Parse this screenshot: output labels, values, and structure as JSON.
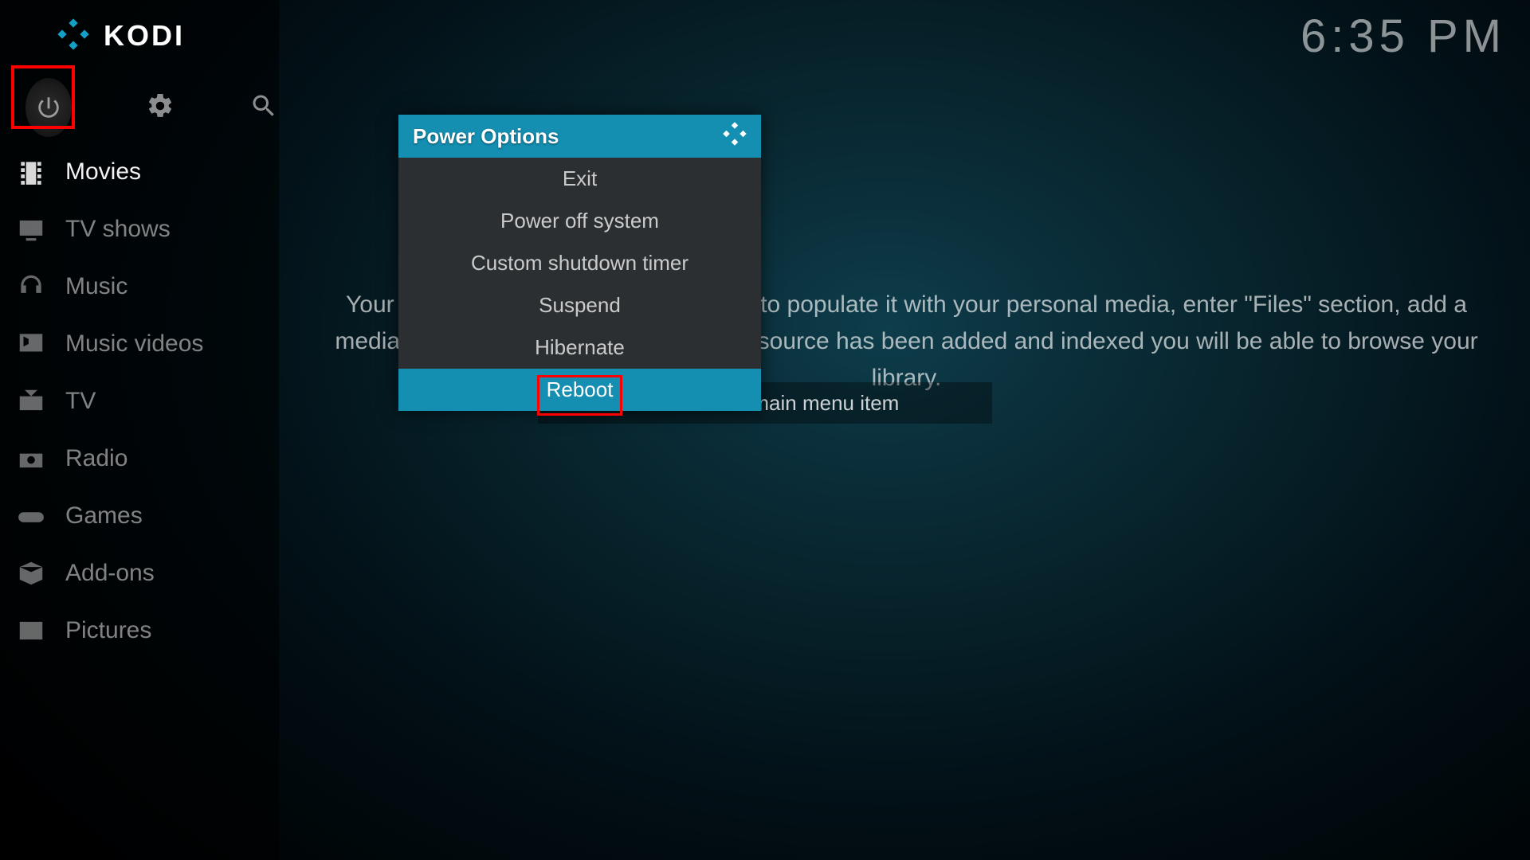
{
  "brand": "KODI",
  "clock": "6:35 PM",
  "sidebar": {
    "items": [
      {
        "icon": "film-icon",
        "label": "Movies",
        "active": true
      },
      {
        "icon": "tv-display-icon",
        "label": "TV shows"
      },
      {
        "icon": "headphones-icon",
        "label": "Music"
      },
      {
        "icon": "music-video-icon",
        "label": "Music videos"
      },
      {
        "icon": "tv-antenna-icon",
        "label": "TV"
      },
      {
        "icon": "radio-icon",
        "label": "Radio"
      },
      {
        "icon": "gamepad-icon",
        "label": "Games"
      },
      {
        "icon": "box-icon",
        "label": "Add-ons"
      },
      {
        "icon": "pictures-icon",
        "label": "Pictures"
      }
    ]
  },
  "background": {
    "hint": "Your library is currently empty. In order to populate it with your personal media, enter \"Files\" section, add a media source and configure it. After the source has been added and indexed you will be able to browse your library.",
    "button": "Remove this main menu item"
  },
  "dialog": {
    "title": "Power Options",
    "options": [
      {
        "label": "Exit"
      },
      {
        "label": "Power off system"
      },
      {
        "label": "Custom shutdown timer"
      },
      {
        "label": "Suspend"
      },
      {
        "label": "Hibernate"
      },
      {
        "label": "Reboot",
        "selected": true
      }
    ]
  }
}
